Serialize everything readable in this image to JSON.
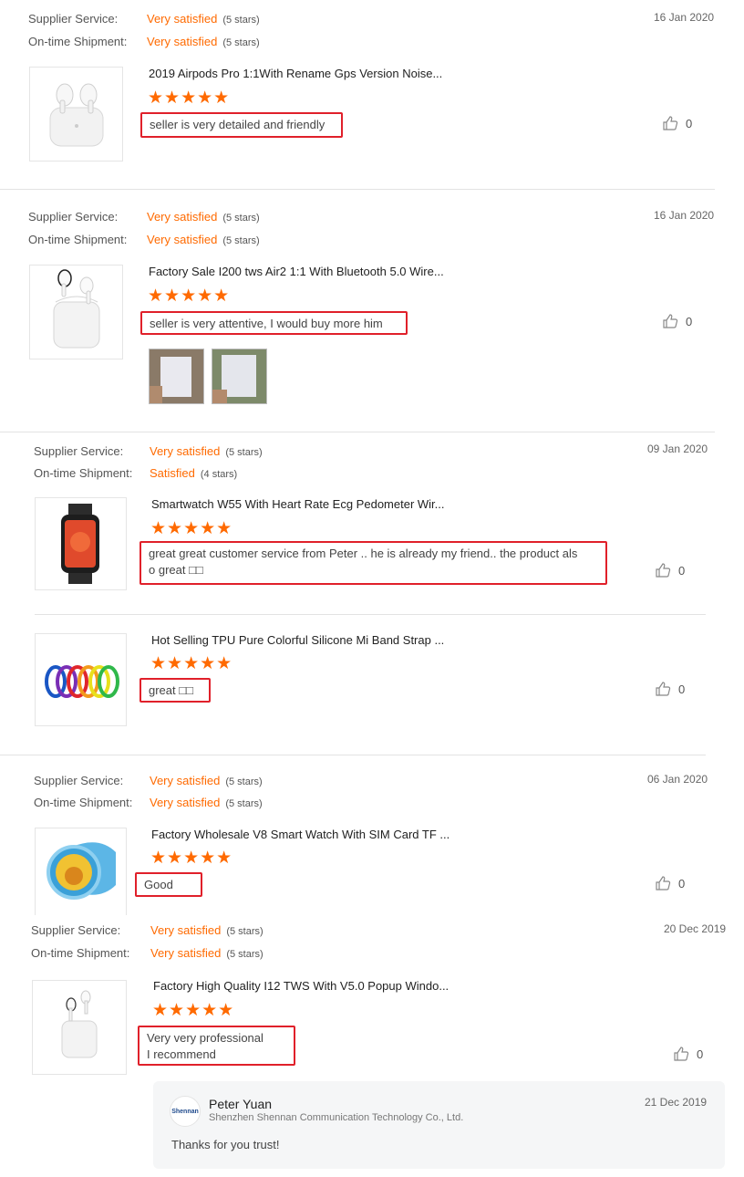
{
  "labels": {
    "supplier": "Supplier Service:",
    "shipment": "On-time Shipment:"
  },
  "stars_glyph": "★★★★★",
  "reviews": [
    {
      "date": "16 Jan 2020",
      "supplier": {
        "rating": "Very satisfied",
        "stars": "(5 stars)"
      },
      "shipment": {
        "rating": "Very satisfied",
        "stars": "(5 stars)"
      },
      "products": [
        {
          "title": "2019 Airpods Pro 1:1With Rename Gps Version Noise...",
          "comment": "seller is very detailed and friendly",
          "likes": "0"
        }
      ]
    },
    {
      "date": "16 Jan 2020",
      "supplier": {
        "rating": "Very satisfied",
        "stars": "(5 stars)"
      },
      "shipment": {
        "rating": "Very satisfied",
        "stars": "(5 stars)"
      },
      "products": [
        {
          "title": "Factory Sale I200 tws Air2 1:1 With Bluetooth 5.0 Wire...",
          "comment": "seller is very attentive, I would buy more him",
          "likes": "0"
        }
      ]
    },
    {
      "date": "09 Jan 2020",
      "supplier": {
        "rating": "Very satisfied",
        "stars": "(5 stars)"
      },
      "shipment": {
        "rating": "Satisfied",
        "stars": "(4 stars)"
      },
      "products": [
        {
          "title": "Smartwatch W55 With Heart Rate Ecg Pedometer Wir...",
          "comment_line1": "great great customer service from Peter .. he is already my friend.. the product als",
          "comment_line2": "o great □□",
          "likes": "0"
        },
        {
          "title": "Hot Selling TPU Pure Colorful Silicone Mi Band Strap ...",
          "comment": "great □□",
          "likes": "0"
        }
      ]
    },
    {
      "date": "06 Jan 2020",
      "supplier": {
        "rating": "Very satisfied",
        "stars": "(5 stars)"
      },
      "shipment": {
        "rating": "Very satisfied",
        "stars": "(5 stars)"
      },
      "products": [
        {
          "title": "Factory Wholesale V8 Smart Watch With SIM Card TF ...",
          "comment": "Good",
          "likes": "0"
        }
      ]
    },
    {
      "date": "20 Dec 2019",
      "supplier": {
        "rating": "Very satisfied",
        "stars": "(5 stars)"
      },
      "shipment": {
        "rating": "Very satisfied",
        "stars": "(5 stars)"
      },
      "products": [
        {
          "title": "Factory High Quality I12 TWS With V5.0 Popup Windo...",
          "comment_line1": "Very very professional",
          "comment_line2": "I recommend",
          "likes": "0"
        }
      ],
      "reply": {
        "logo_text": "Shennan",
        "name": "Peter Yuan",
        "company": "Shenzhen Shennan Communication Technology Co., Ltd.",
        "date": "21 Dec 2019",
        "text": "Thanks for you trust!"
      }
    }
  ],
  "colors": {
    "accent": "#ff6a00",
    "highlight_box": "#e0202a"
  },
  "icons": [
    "thumbs-up-icon"
  ]
}
